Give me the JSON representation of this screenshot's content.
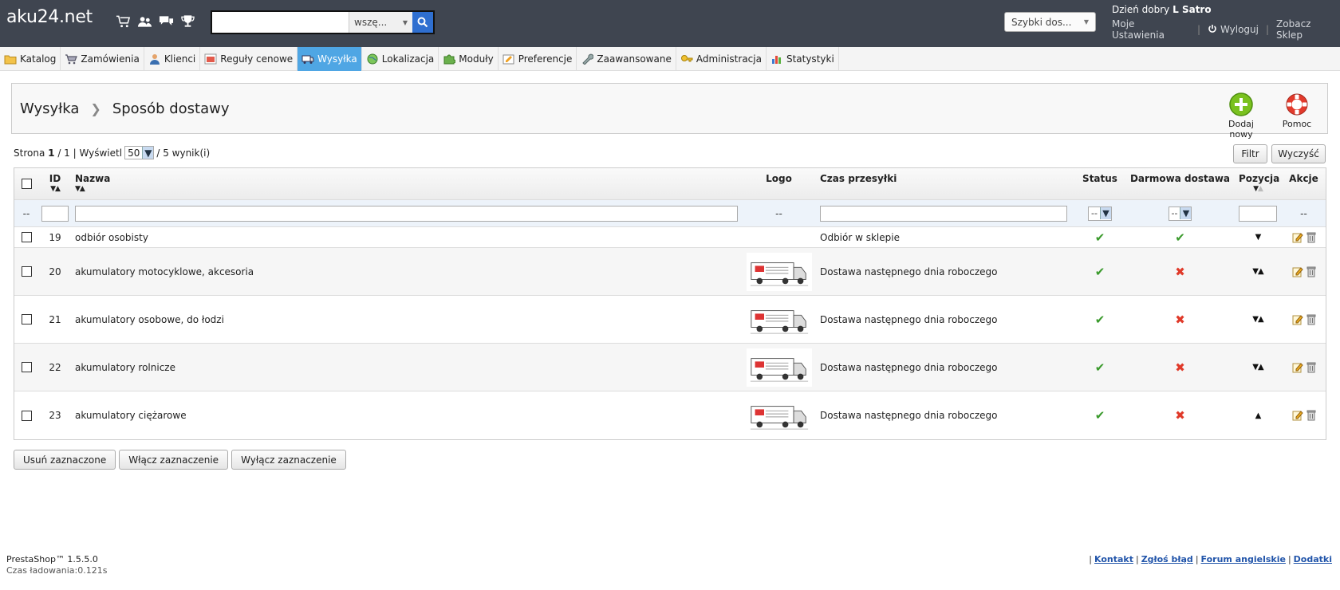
{
  "header": {
    "logo": "aku24.net",
    "icons": [
      "cart-icon",
      "customers-icon",
      "messages-icon",
      "trophy-icon"
    ],
    "search": {
      "value": "",
      "scope": "wszę..."
    },
    "quick_access": "Szybki dos...",
    "greeting_prefix": "Dzień dobry",
    "user_name": "L Satro",
    "links": {
      "settings": "Moje Ustawienia",
      "logout": "Wyloguj",
      "view_shop": "Zobacz Sklep"
    }
  },
  "menu": [
    {
      "label": "Katalog",
      "icon": "folder-icon"
    },
    {
      "label": "Zamówienia",
      "icon": "cart-icon"
    },
    {
      "label": "Klienci",
      "icon": "user-icon"
    },
    {
      "label": "Reguły cenowe",
      "icon": "price-rules-icon"
    },
    {
      "label": "Wysyłka",
      "icon": "truck-icon",
      "active": true
    },
    {
      "label": "Lokalizacja",
      "icon": "globe-icon"
    },
    {
      "label": "Moduły",
      "icon": "puzzle-icon"
    },
    {
      "label": "Preferencje",
      "icon": "preferences-icon"
    },
    {
      "label": "Zaawansowane",
      "icon": "wrench-icon"
    },
    {
      "label": "Administracja",
      "icon": "key-icon"
    },
    {
      "label": "Statystyki",
      "icon": "chart-icon"
    }
  ],
  "toolbar": {
    "breadcrumb": [
      "Wysyłka",
      "Sposób dostawy"
    ],
    "add_new": "Dodaj nowy",
    "help": "Pomoc"
  },
  "pagination": {
    "page_label": "Strona",
    "page": "1",
    "of": "/ 1 | Wyświetl",
    "per_page": "50",
    "results": "/ 5 wynik(i)"
  },
  "buttons": {
    "filter": "Filtr",
    "reset": "Wyczyść"
  },
  "table": {
    "headers": {
      "id": "ID",
      "name": "Nazwa",
      "logo": "Logo",
      "delay": "Czas przesyłki",
      "status": "Status",
      "free": "Darmowa dostawa",
      "position": "Pozycja",
      "actions": "Akcje"
    },
    "filters": {
      "chk": "--",
      "logo": "--",
      "status": "--",
      "free": "--",
      "actions": "--"
    },
    "rows": [
      {
        "id": "19",
        "name": "odbiór osobisty",
        "delay": "Odbiór w sklepie",
        "status": true,
        "free": true,
        "position": "down"
      },
      {
        "id": "20",
        "name": "akumulatory motocyklowe, akcesoria",
        "delay": "Dostawa następnego dnia roboczego",
        "status": true,
        "free": false,
        "position": "both"
      },
      {
        "id": "21",
        "name": "akumulatory osobowe, do łodzi",
        "delay": "Dostawa następnego dnia roboczego",
        "status": true,
        "free": false,
        "position": "both"
      },
      {
        "id": "22",
        "name": "akumulatory rolnicze",
        "delay": "Dostawa następnego dnia roboczego",
        "status": true,
        "free": false,
        "position": "both"
      },
      {
        "id": "23",
        "name": "akumulatory ciężarowe",
        "delay": "Dostawa następnego dnia roboczego",
        "status": true,
        "free": false,
        "position": "up"
      }
    ]
  },
  "bulk": {
    "delete": "Usuń zaznaczone",
    "enable": "Włącz zaznaczenie",
    "disable": "Wyłącz zaznaczenie"
  },
  "footer": {
    "version": "PrestaShop™ 1.5.5.0",
    "load_time": "Czas ładowania:0.121s",
    "links": [
      "Kontakt",
      "Zgłoś błąd",
      "Forum angielskie",
      "Dodatki"
    ]
  },
  "colors": {
    "header_bg": "#3f4550",
    "active_menu": "#4fa6e4",
    "ok": "#3a9a2c",
    "ko": "#e03a2a"
  }
}
